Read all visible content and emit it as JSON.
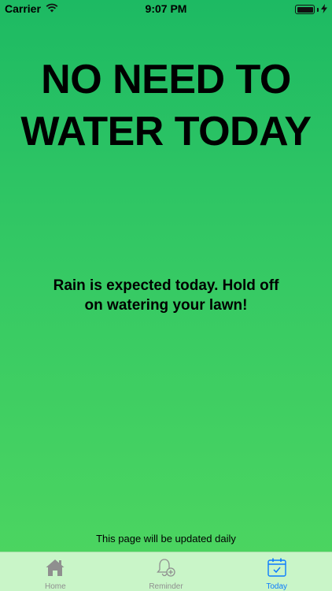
{
  "status_bar": {
    "carrier": "Carrier",
    "time": "9:07 PM",
    "icons": [
      "wifi-icon",
      "battery-icon",
      "charging-bolt-icon"
    ]
  },
  "headline": {
    "line1": "NO NEED TO",
    "line2": "WATER TODAY"
  },
  "message": "Rain is expected today. Hold off on watering your lawn!",
  "footnote": "This page will be updated daily",
  "tab_bar": {
    "tabs": [
      {
        "label": "Home",
        "icon": "home-icon",
        "active": false
      },
      {
        "label": "Reminder",
        "icon": "bell-plus-icon",
        "active": false
      },
      {
        "label": "Today",
        "icon": "calendar-check-icon",
        "active": true
      }
    ]
  },
  "colors": {
    "background_top": "#1dba63",
    "background_bottom": "#4ed660",
    "tab_bar": "#c9f5c8",
    "active_tab": "#0a7bff",
    "inactive_tab": "#8f8f8f"
  }
}
